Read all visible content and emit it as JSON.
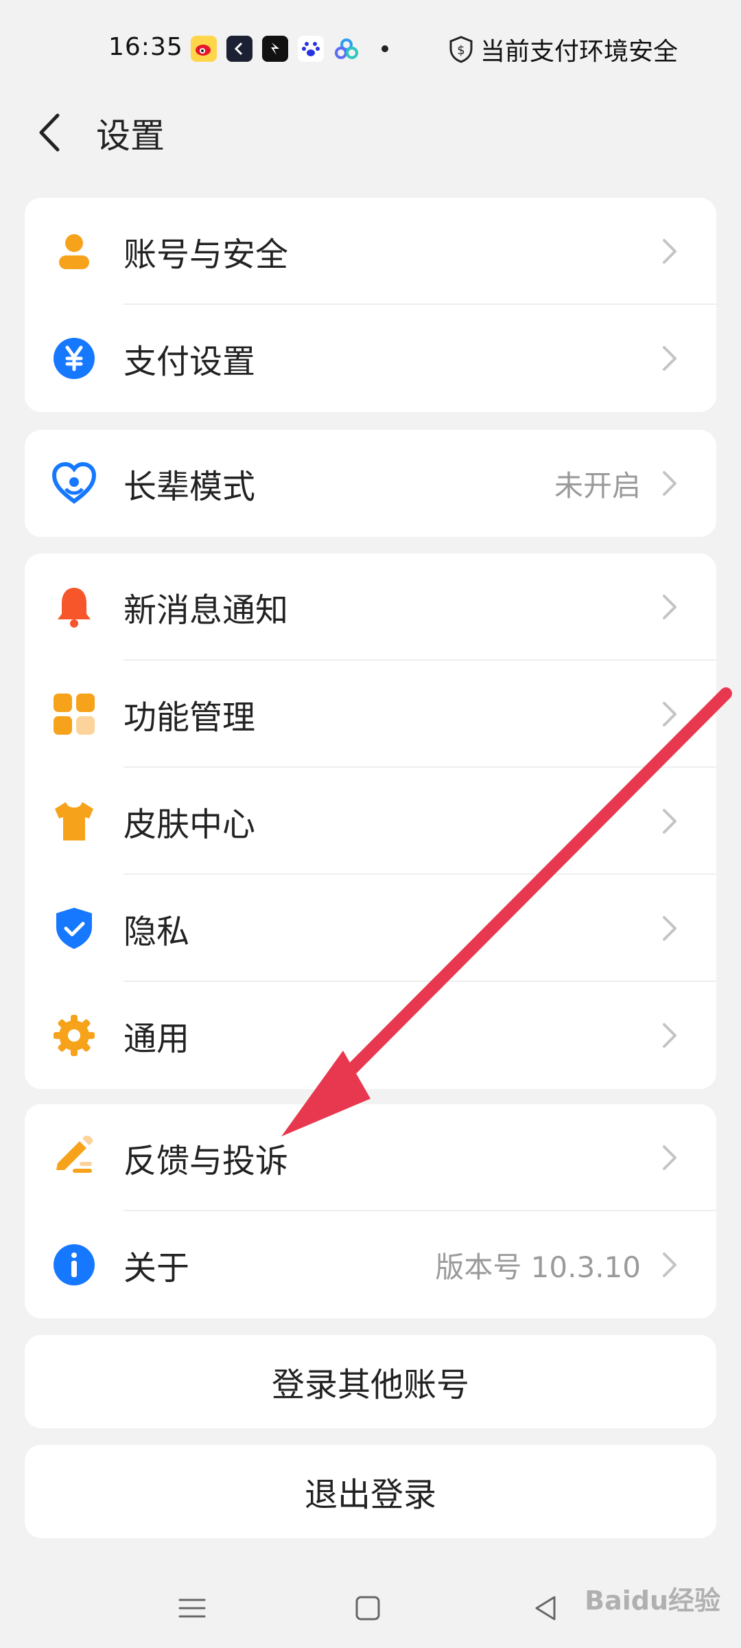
{
  "status_bar": {
    "time": "16:35",
    "security_text": "当前支付环境安全",
    "app_icons": [
      "weibo-icon",
      "app-k-icon",
      "app-arrow-icon",
      "baidu-paw-icon",
      "multi-circle-icon"
    ]
  },
  "header": {
    "title": "设置"
  },
  "groups": [
    {
      "items": [
        {
          "label": "账号与安全",
          "icon": "user-icon",
          "color": "#f7a21b"
        },
        {
          "label": "支付设置",
          "icon": "yuan-icon",
          "color": "#1677ff"
        }
      ]
    },
    {
      "items": [
        {
          "label": "长辈模式",
          "value": "未开启",
          "icon": "heart-icon",
          "color": "#1677ff"
        }
      ]
    },
    {
      "items": [
        {
          "label": "新消息通知",
          "icon": "bell-icon",
          "color": "#f7562a"
        },
        {
          "label": "功能管理",
          "icon": "grid-icon",
          "color": "#f7a21b"
        },
        {
          "label": "皮肤中心",
          "icon": "tshirt-icon",
          "color": "#f7a21b"
        },
        {
          "label": "隐私",
          "icon": "shield-check-icon",
          "color": "#1677ff"
        },
        {
          "label": "通用",
          "icon": "gear-icon",
          "color": "#f7a21b"
        }
      ]
    },
    {
      "items": [
        {
          "label": "反馈与投诉",
          "icon": "pen-icon",
          "color": "#f7a21b"
        },
        {
          "label": "关于",
          "value": "版本号 10.3.10",
          "icon": "info-icon",
          "color": "#1677ff"
        }
      ]
    }
  ],
  "buttons": {
    "switch_account": "登录其他账号",
    "logout": "退出登录"
  },
  "watermark": "Baidu经验",
  "colors": {
    "arrow": "#e8384f",
    "background": "#f2f2f2"
  }
}
